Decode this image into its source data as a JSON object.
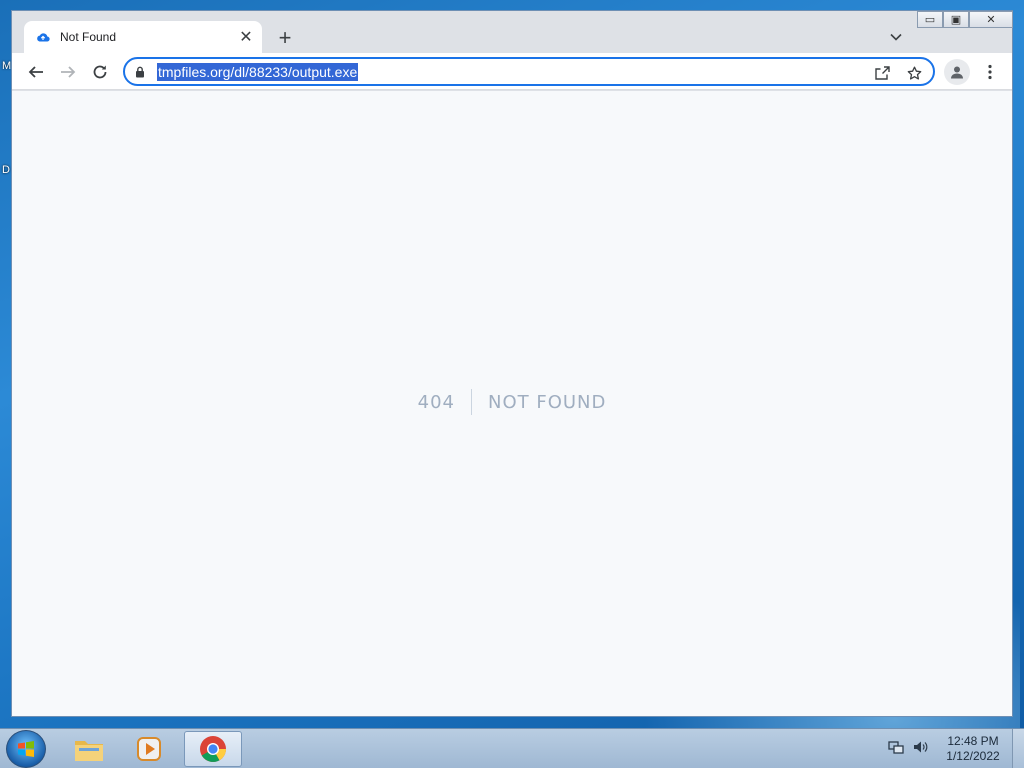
{
  "desktop": {
    "labels": [
      "M",
      "D"
    ]
  },
  "browser": {
    "tab": {
      "title": "Not Found",
      "close_glyph": "✕"
    },
    "new_tab_glyph": "+",
    "window_controls": {
      "minimize": "▭",
      "restore": "▣",
      "close": "✕"
    },
    "address_bar": {
      "url": "tmpfiles.org/dl/88233/output.exe"
    }
  },
  "page": {
    "error_code": "404",
    "error_message": "NOT FOUND"
  },
  "taskbar": {
    "clock_time": "12:48 PM",
    "clock_date": "1/12/2022"
  },
  "colors": {
    "accent": "#1a73e8",
    "selection": "#3367d6",
    "error_text": "#a0aec0"
  }
}
